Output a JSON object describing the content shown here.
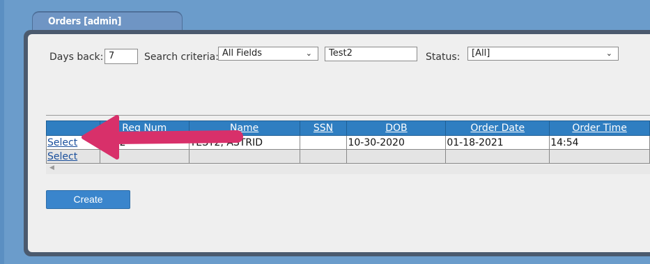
{
  "window": {
    "tab_title": "Orders [admin]"
  },
  "filters": {
    "days_back_label": "Days back:",
    "days_back_value": "7",
    "search_criteria_label": "Search criteria:",
    "search_criteria_value": "All Fields",
    "search_text_value": "Test2",
    "status_label": "Status:",
    "status_value": "[All]"
  },
  "table": {
    "headers": [
      "",
      "Req Num",
      "Name",
      "SSN",
      "DOB",
      "Order Date",
      "Order Time"
    ],
    "rows": [
      {
        "action": "Select",
        "req_num": "0072",
        "name": "TEST2, ASTRID",
        "ssn": "",
        "dob": "10-30-2020",
        "order_date": "01-18-2021",
        "order_time": "14:54"
      },
      {
        "action": "Select",
        "req_num": "",
        "name": "",
        "ssn": "",
        "dob": "",
        "order_date": "",
        "order_time": ""
      }
    ]
  },
  "actions": {
    "create_label": "Create"
  },
  "colors": {
    "header_blue": "#2f7ec1",
    "annotation_arrow": "#d8306a",
    "button_blue": "#3a85cc"
  }
}
